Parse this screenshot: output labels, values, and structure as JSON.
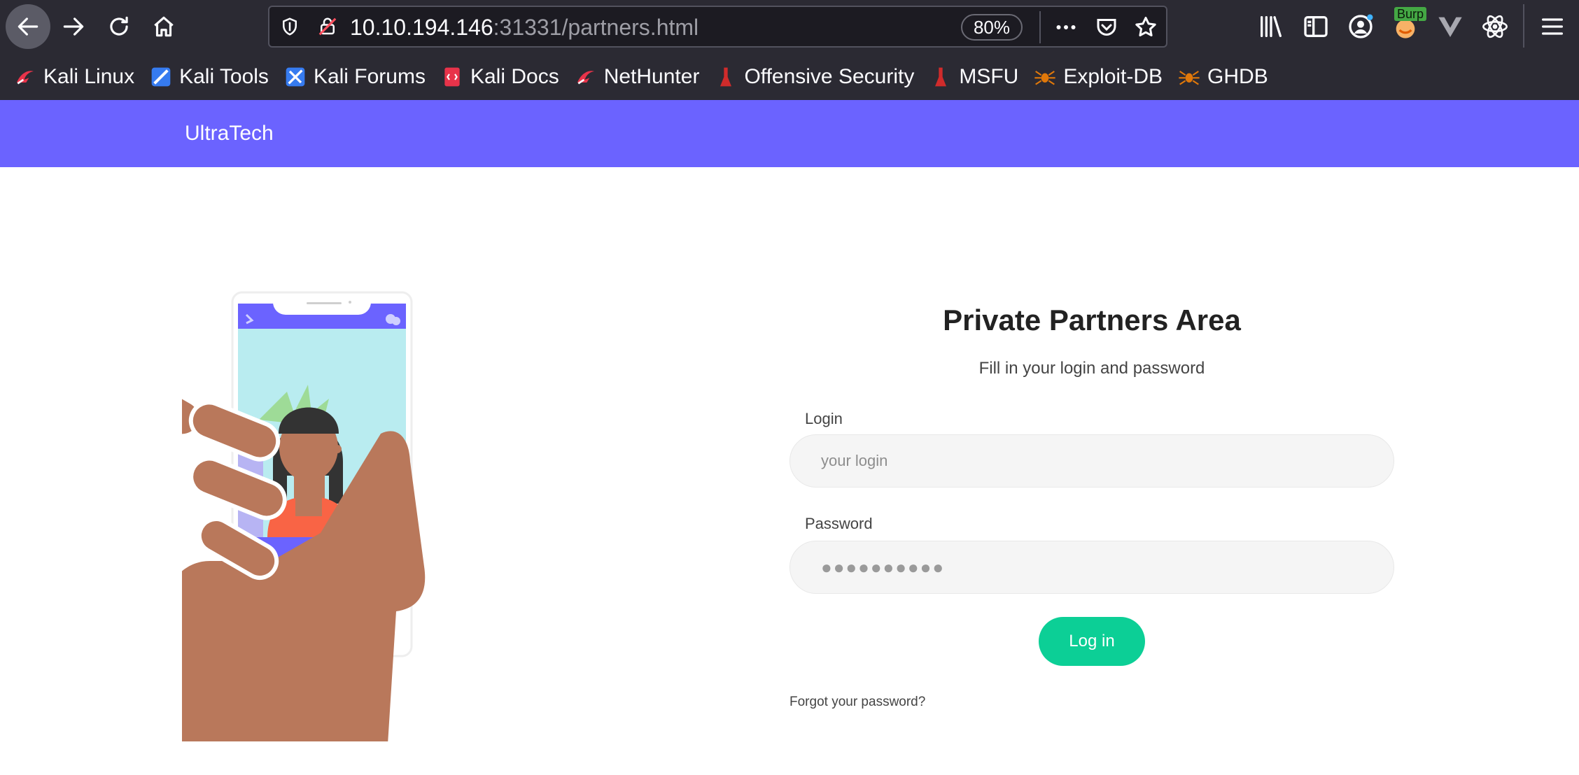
{
  "browser": {
    "url_host": "10.10.194.146",
    "url_rest": ":31331/partners.html",
    "zoom": "80%",
    "burp_label": "Burp",
    "bookmarks": [
      {
        "label": "Kali Linux",
        "icon": "kali-dragon-icon"
      },
      {
        "label": "Kali Tools",
        "icon": "kali-tools-icon"
      },
      {
        "label": "Kali Forums",
        "icon": "kali-forums-icon"
      },
      {
        "label": "Kali Docs",
        "icon": "kali-docs-icon"
      },
      {
        "label": "NetHunter",
        "icon": "kali-dragon-icon"
      },
      {
        "label": "Offensive Security",
        "icon": "offsec-icon"
      },
      {
        "label": "MSFU",
        "icon": "offsec-icon"
      },
      {
        "label": "Exploit-DB",
        "icon": "exploitdb-spider-icon"
      },
      {
        "label": "GHDB",
        "icon": "exploitdb-spider-icon"
      }
    ]
  },
  "site": {
    "brand": "UltraTech",
    "header_color": "#6b63ff"
  },
  "login": {
    "title": "Private Partners Area",
    "subtitle": "Fill in your login and password",
    "login_label": "Login",
    "login_placeholder": "your login",
    "login_value": "",
    "password_label": "Password",
    "password_value": "●●●●●●●●●●",
    "submit_label": "Log in",
    "forgot_label": "Forgot your password?",
    "accent_color": "#0ccf96"
  }
}
